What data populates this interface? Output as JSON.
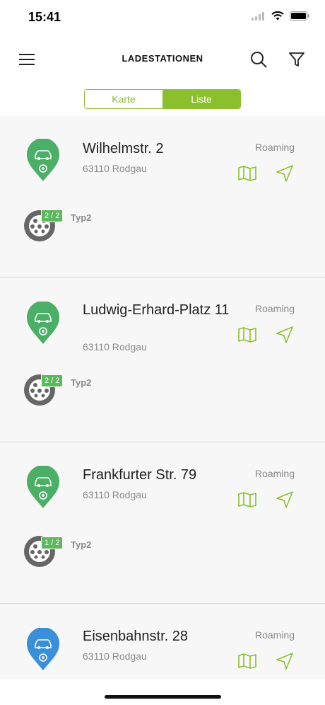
{
  "status_bar": {
    "time": "15:41"
  },
  "header": {
    "title": "LADESTATIONEN"
  },
  "segment": {
    "map_label": "Karte",
    "list_label": "Liste"
  },
  "stations": [
    {
      "name": "Wilhelmstr. 2",
      "city": "63110 Rodgau",
      "roaming": "Roaming",
      "pin_color": "#4caf68",
      "availability": "2 / 2",
      "connector_type": "Typ2"
    },
    {
      "name": "Ludwig-Erhard-Platz 11",
      "city": "63110 Rodgau",
      "roaming": "Roaming",
      "pin_color": "#4caf68",
      "availability": "2 / 2",
      "connector_type": "Typ2"
    },
    {
      "name": "Frankfurter Str. 79",
      "city": "63110 Rodgau",
      "roaming": "Roaming",
      "pin_color": "#4caf68",
      "availability": "1 / 2",
      "connector_type": "Typ2"
    },
    {
      "name": "Eisenbahnstr. 28",
      "city": "63110 Rodgau",
      "roaming": "Roaming",
      "pin_color": "#3a8fd9",
      "availability": "",
      "connector_type": ""
    }
  ],
  "colors": {
    "accent": "#8cbf2d",
    "available": "#5cb85c"
  }
}
